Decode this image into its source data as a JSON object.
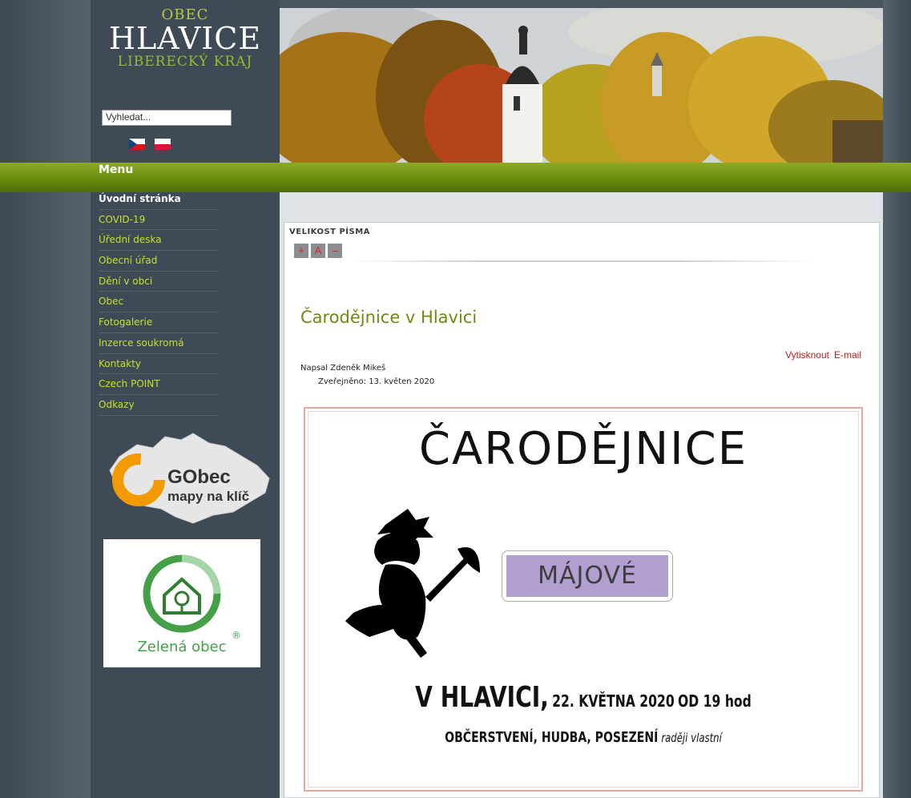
{
  "logo": {
    "line1": "OBEC",
    "line2": "HLAVICE",
    "line3": "LIBERECKÝ KRAJ"
  },
  "search": {
    "placeholder": "Vyhledat..."
  },
  "flags": [
    "flag-cz-icon",
    "flag-pl-icon"
  ],
  "menu": {
    "title": "Menu",
    "items": [
      "Úvodní stránka",
      "COVID-19",
      "Úřední deska",
      "Obecní úřad",
      "Dění v obci",
      "Obec",
      "Fotogalerie",
      "Inzerce soukromá",
      "Kontakty",
      "Czech POINT",
      "Odkazy"
    ]
  },
  "banners": {
    "gobec_name": "GObec",
    "gobec_tagline": "mapy na klíč",
    "zelena_obec": "Zelená obec",
    "registered": "®"
  },
  "font_size": {
    "label": "VELIKOST PÍSMA",
    "increase": "+",
    "reset": "A",
    "decrease": "–"
  },
  "article": {
    "title": "Čarodějnice v Hlavici",
    "print": "Vytisknout",
    "email": "E-mail",
    "author": "Napsal Zdeněk Mikeš",
    "published": "Zveřejněno: 13. květen 2020"
  },
  "poster": {
    "title": "ČARODĚJNICE",
    "tag": "MÁJOVÉ",
    "place": "V HLAVICI,",
    "date": "22. KVĚTNA 2020",
    "time": "OD 19 hod",
    "services": "OBČERSTVENÍ, HUDBA, POSEZENÍ",
    "note": "raději vlastní"
  },
  "colors": {
    "accent_green": "#6f8a12",
    "menu_link": "#c7e02a",
    "link_red": "#c01b1b",
    "sidebar_bg": "#3e4a55"
  }
}
